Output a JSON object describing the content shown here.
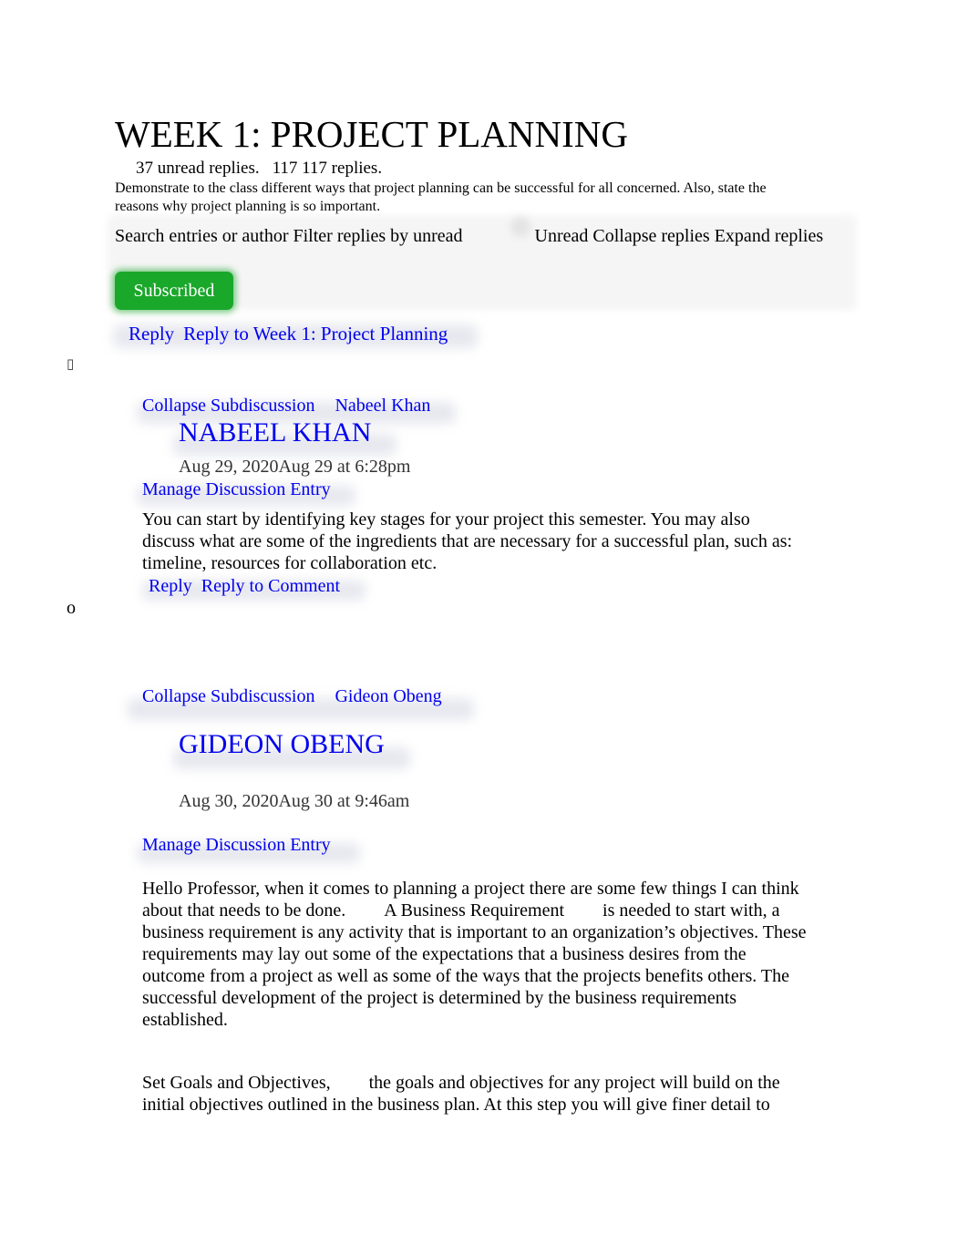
{
  "topic": {
    "title": "WEEK 1: PROJECT PLANNING",
    "unread_replies": "37 unread replies.",
    "total_replies": "117 117 replies.",
    "description": "Demonstrate to the class different ways that project planning can be successful for all concerned. Also, state the reasons why project planning is so important."
  },
  "toolbar": {
    "search_label": "Search entries or author",
    "filter_label": "Filter replies by unread",
    "unread_label": "Unread",
    "collapse_label": "Collapse replies",
    "expand_label": "Expand replies",
    "subscribed_label": "Subscribed",
    "subscribed_color": "#1aa82b"
  },
  "topic_reply": {
    "reply_label": "Reply",
    "reply_to_label": "Reply to Week 1: Project Planning"
  },
  "list_markers": {
    "first": "▯",
    "second": "o"
  },
  "entries": [
    {
      "collapse_label": "Collapse Subdiscussion",
      "author_link": "Nabeel Khan",
      "author_heading": "NABEEL KHAN",
      "date": "Aug 29, 2020Aug 29 at 6:28pm",
      "manage_label": "Manage Discussion Entry",
      "body": "You can start by identifying key stages for your project this semester. You may also discuss what are some of the ingredients that are necessary for a successful plan, such as: timeline, resources for collaboration etc.",
      "reply_label": "Reply",
      "reply_to_label": "Reply to Comment"
    },
    {
      "collapse_label": "Collapse Subdiscussion",
      "author_link": "Gideon Obeng",
      "author_heading": "GIDEON OBENG",
      "date": "Aug 30, 2020Aug 30 at 9:46am",
      "manage_label": "Manage Discussion Entry",
      "body_p1_a": "Hello Professor, when it comes to planning a project there are some few things I can think about that needs to be done.",
      "body_p1_b": "A Business Requirement",
      "body_p1_c": "is needed to start with, a business requirement is any activity that is important to an organization’s objectives. These requirements may lay out some of the expectations that a business desires from the outcome from a project as well as some of the ways that the projects benefits others. The successful development of the project is determined by the business requirements established.",
      "body_p2_a": "Set Goals and Objectives,",
      "body_p2_b": "the goals and objectives for any project will build on the initial objectives outlined in the business plan. At this step you will give finer detail to"
    }
  ],
  "colors": {
    "link": "#0000ee",
    "text": "#000000",
    "date": "#333333"
  }
}
